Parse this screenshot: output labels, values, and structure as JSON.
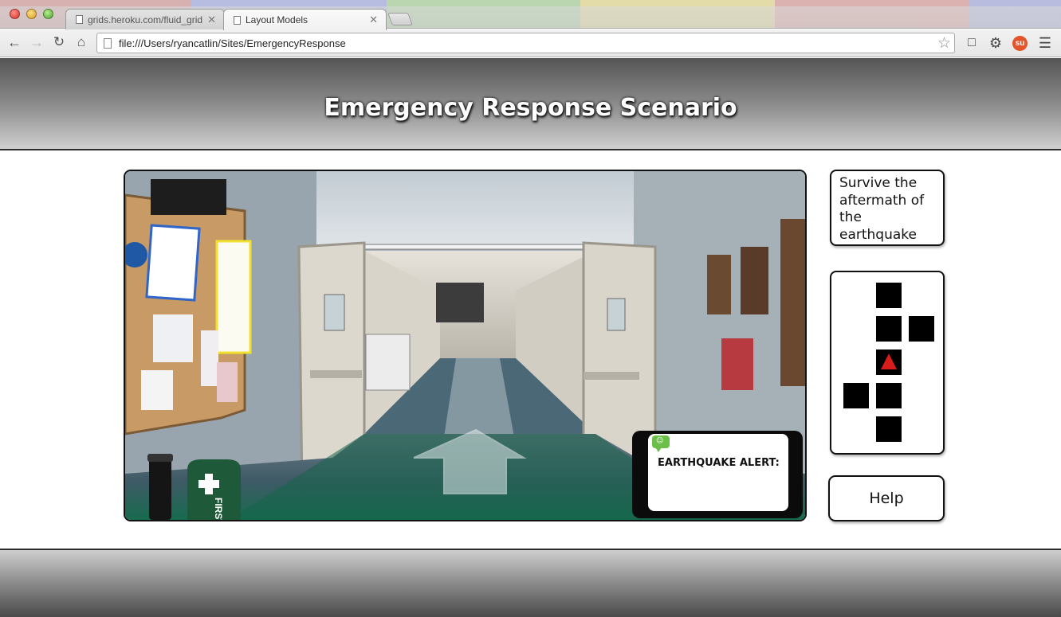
{
  "browser": {
    "tabs": [
      {
        "title": "grids.heroku.com/fluid_grid",
        "active": false
      },
      {
        "title": "Layout Models",
        "active": true
      }
    ],
    "address": "file:///Users/ryancatlin/Sites/EmergencyResponse",
    "icons": {
      "back": "back-arrow-icon",
      "forward": "forward-arrow-icon",
      "reload": "reload-icon",
      "home": "home-icon",
      "bookmark": "star-icon",
      "extension_device": "device-extension-icon",
      "settings": "gear-icon",
      "stumbleupon": "stumbleupon-icon",
      "menu": "hamburger-menu-icon"
    },
    "tab_strip_colors": [
      "#d6b1b0",
      "#b6bde0",
      "#b9d6b0",
      "#e3dca9",
      "#dcb2b1",
      "#b8bde0"
    ]
  },
  "header": {
    "title": "Emergency Response Scenario"
  },
  "scene": {
    "items": [
      "flashlight",
      "first-aid-kit"
    ],
    "first_aid_label": "FIRST AID",
    "navigation_arrow": "forward",
    "alert": {
      "title": "EARTHQUAKE ALERT:",
      "message": ""
    }
  },
  "objective": {
    "text": "Survive the aftermath of the earthquake"
  },
  "minimap": {
    "cell_color": "#000000",
    "marker_color": "#d81b1b"
  },
  "help": {
    "label": "Help"
  }
}
